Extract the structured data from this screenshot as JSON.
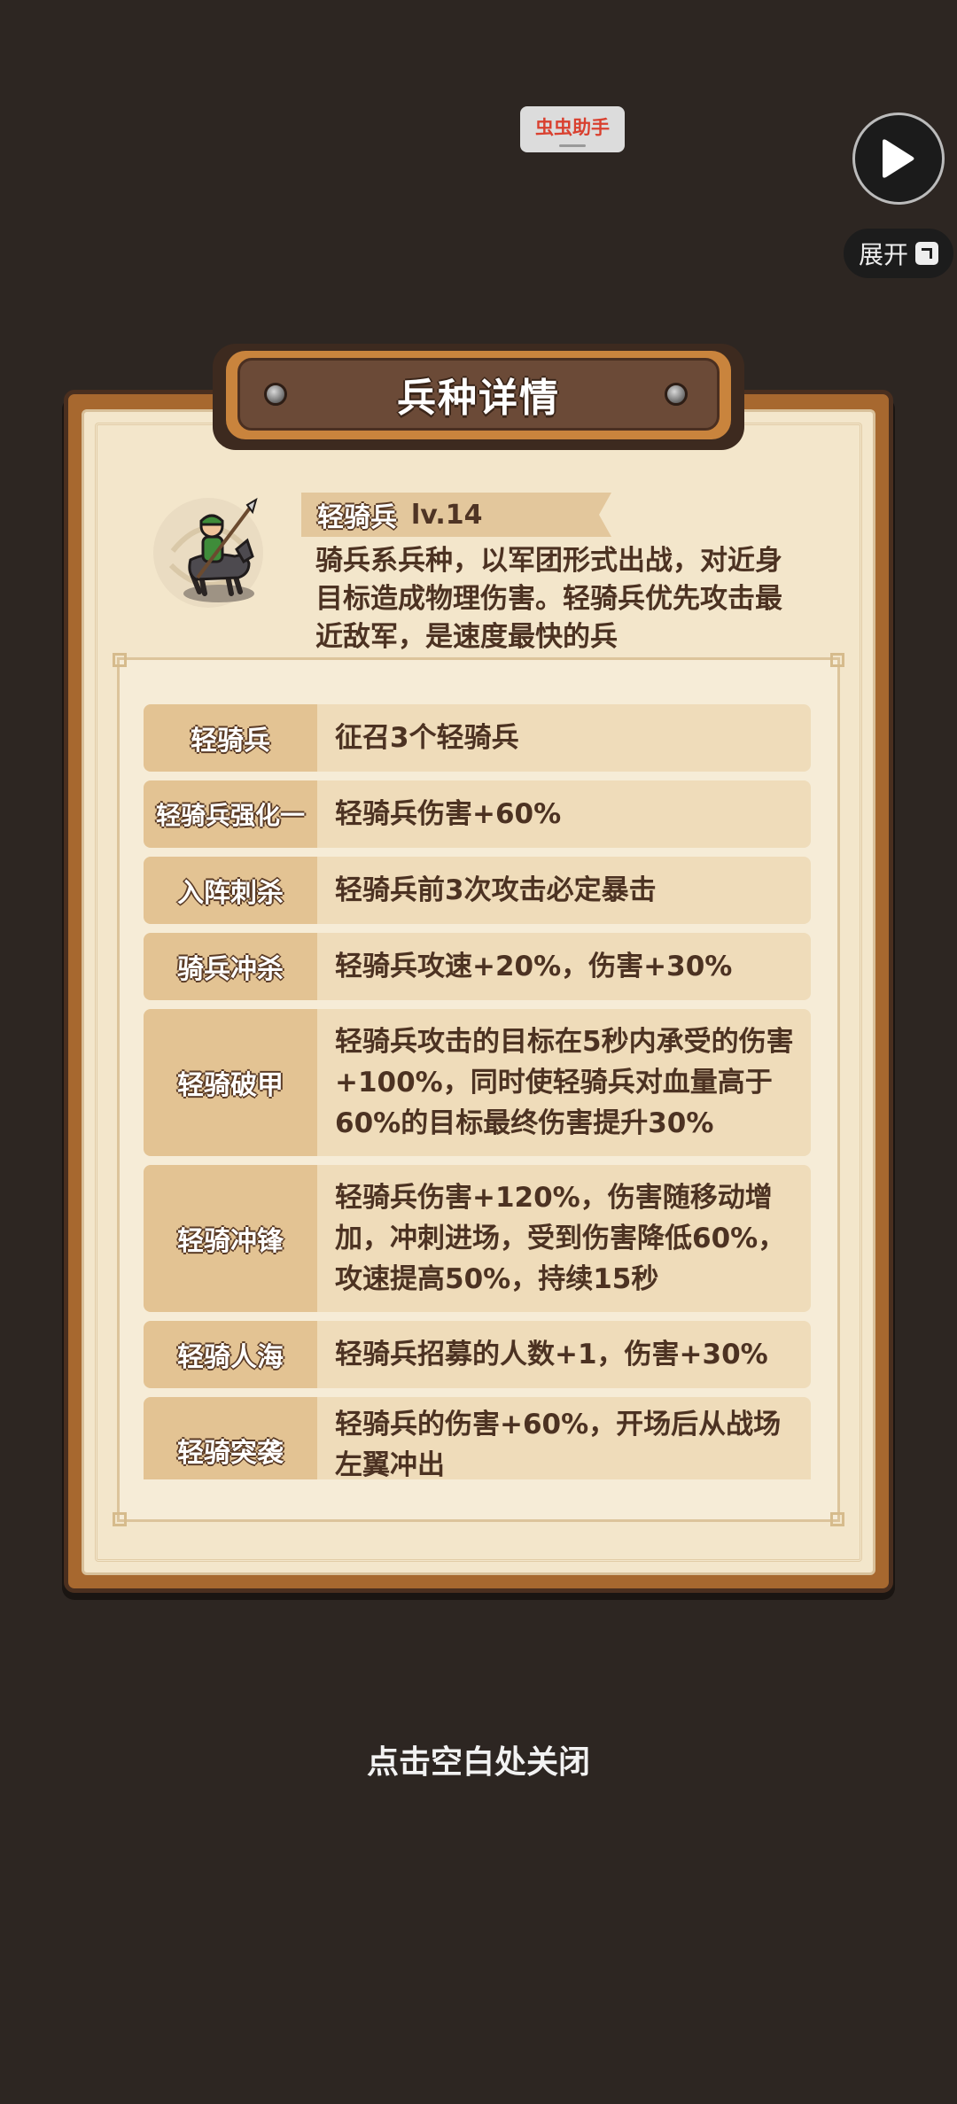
{
  "overlay": {
    "helper_label": "虫虫助手",
    "expand_label": "展开"
  },
  "panel": {
    "title": "兵种详情",
    "unit": {
      "name": "轻骑兵",
      "level": "lv.14",
      "description": "骑兵系兵种，以军团形式出战，对近身目标造成物理伤害。轻骑兵优先攻击最近敌军，是速度最快的兵"
    },
    "skills": [
      {
        "name": "轻骑兵",
        "effect": "征召3个轻骑兵"
      },
      {
        "name": "轻骑兵强化一",
        "effect": "轻骑兵伤害+60%"
      },
      {
        "name": "入阵刺杀",
        "effect": "轻骑兵前3次攻击必定暴击"
      },
      {
        "name": "骑兵冲杀",
        "effect": "轻骑兵攻速+20%，伤害+30%"
      },
      {
        "name": "轻骑破甲",
        "effect": "轻骑兵攻击的目标在5秒内承受的伤害+100%，同时使轻骑兵对血量高于60%的目标最终伤害提升30%"
      },
      {
        "name": "轻骑冲锋",
        "effect": "轻骑兵伤害+120%，伤害随移动增加，冲刺进场，受到伤害降低60%，攻速提高50%，持续15秒"
      },
      {
        "name": "轻骑人海",
        "effect": "轻骑兵招募的人数+1，伤害+30%"
      },
      {
        "name": "轻骑突袭",
        "effect": "轻骑兵的伤害+60%，开场后从战场左翼冲出"
      }
    ]
  },
  "close_hint": "点击空白处关闭",
  "icons": {
    "play": "play-icon",
    "expand": "expand-icon",
    "avatar": "light-cavalry-avatar"
  }
}
